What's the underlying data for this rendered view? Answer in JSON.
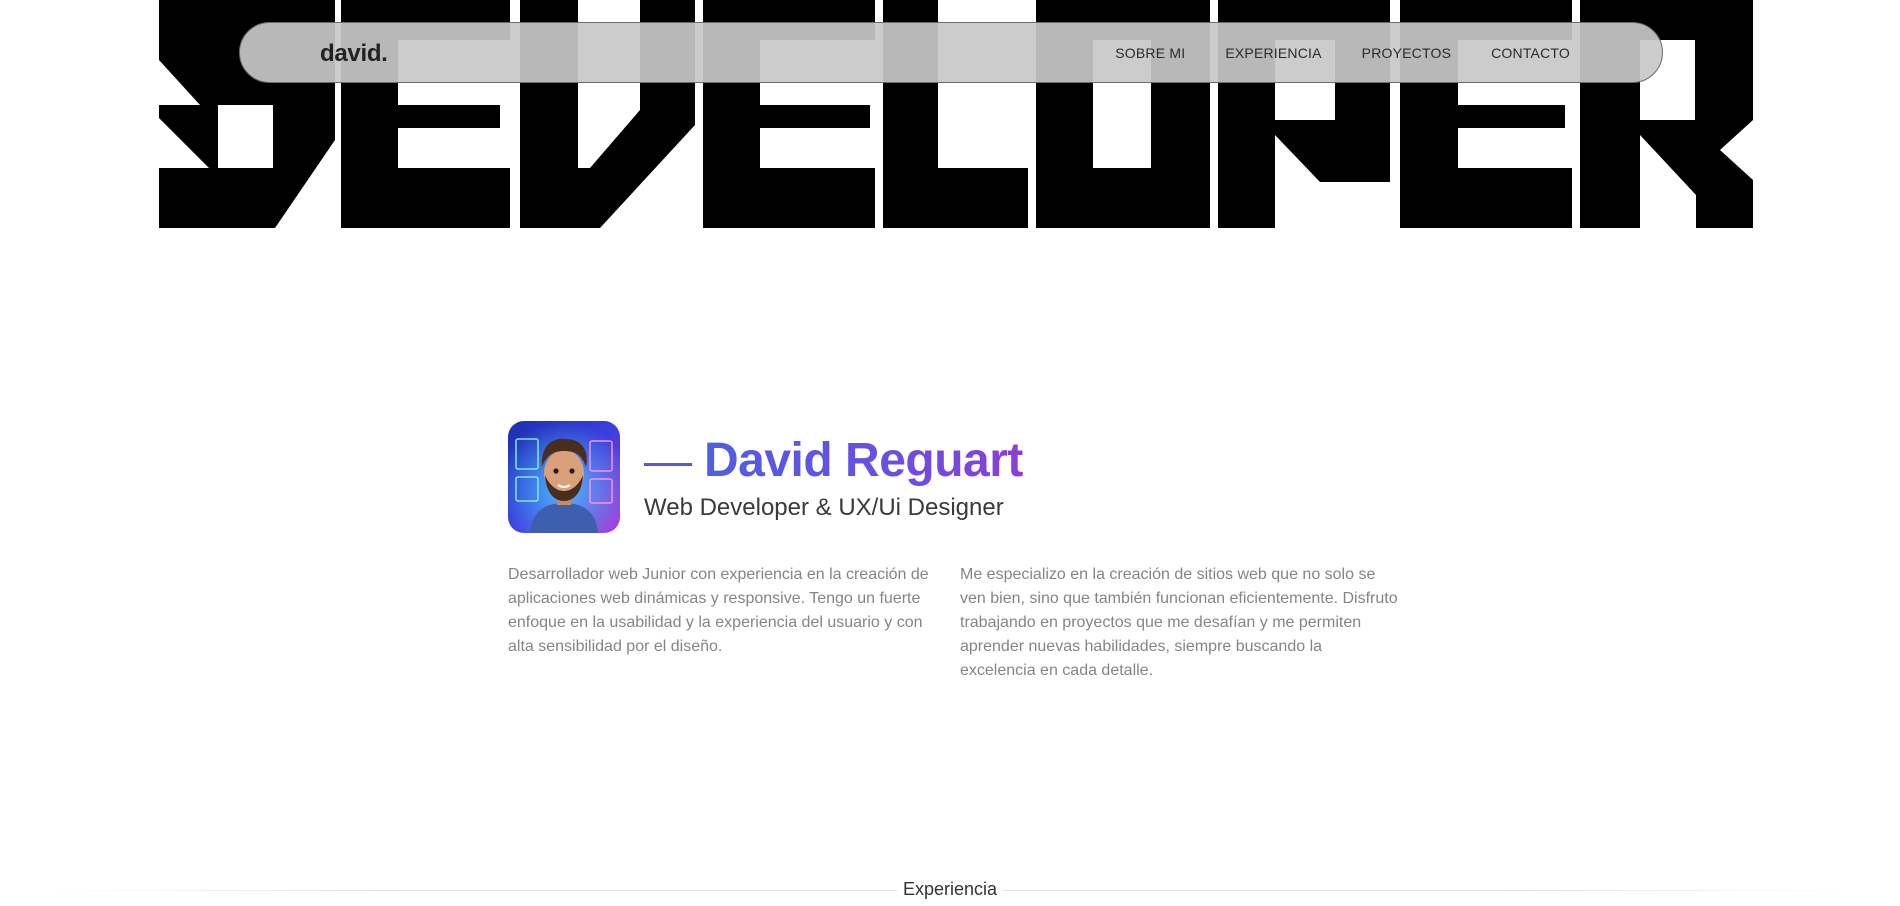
{
  "hero": {
    "word": "DEVELOPER",
    "icon": "developer-wordmark"
  },
  "nav": {
    "brand": "david.",
    "links": [
      {
        "label": "SOBRE MI"
      },
      {
        "label": "EXPERIENCIA"
      },
      {
        "label": "PROYECTOS"
      },
      {
        "label": "CONTACTO"
      }
    ]
  },
  "profile": {
    "name": "David Reguart",
    "role": "Web Developer & UX/Ui Designer",
    "avatar_icon": "avatar-illustration",
    "paragraph_left": "Desarrollador web Junior con experiencia en la creación de aplicaciones web dinámicas y responsive. Tengo un fuerte enfoque en la usabilidad y la experiencia del usuario y con alta sensibilidad por el diseño.",
    "paragraph_right": "Me especializo en la creación de sitios web que no solo se ven bien, sino que también funcionan eficientemente. Disfruto trabajando en proyectos que me desafían y me permiten aprender nuevas habilidades, siempre buscando la excelencia en cada detalle."
  },
  "experience": {
    "title": "Experiencia"
  },
  "colors": {
    "accent_start": "#4f5fe0",
    "accent_end": "#8a3fd6",
    "hero": "#000000",
    "navbar_bg": "#c8c8c8"
  }
}
